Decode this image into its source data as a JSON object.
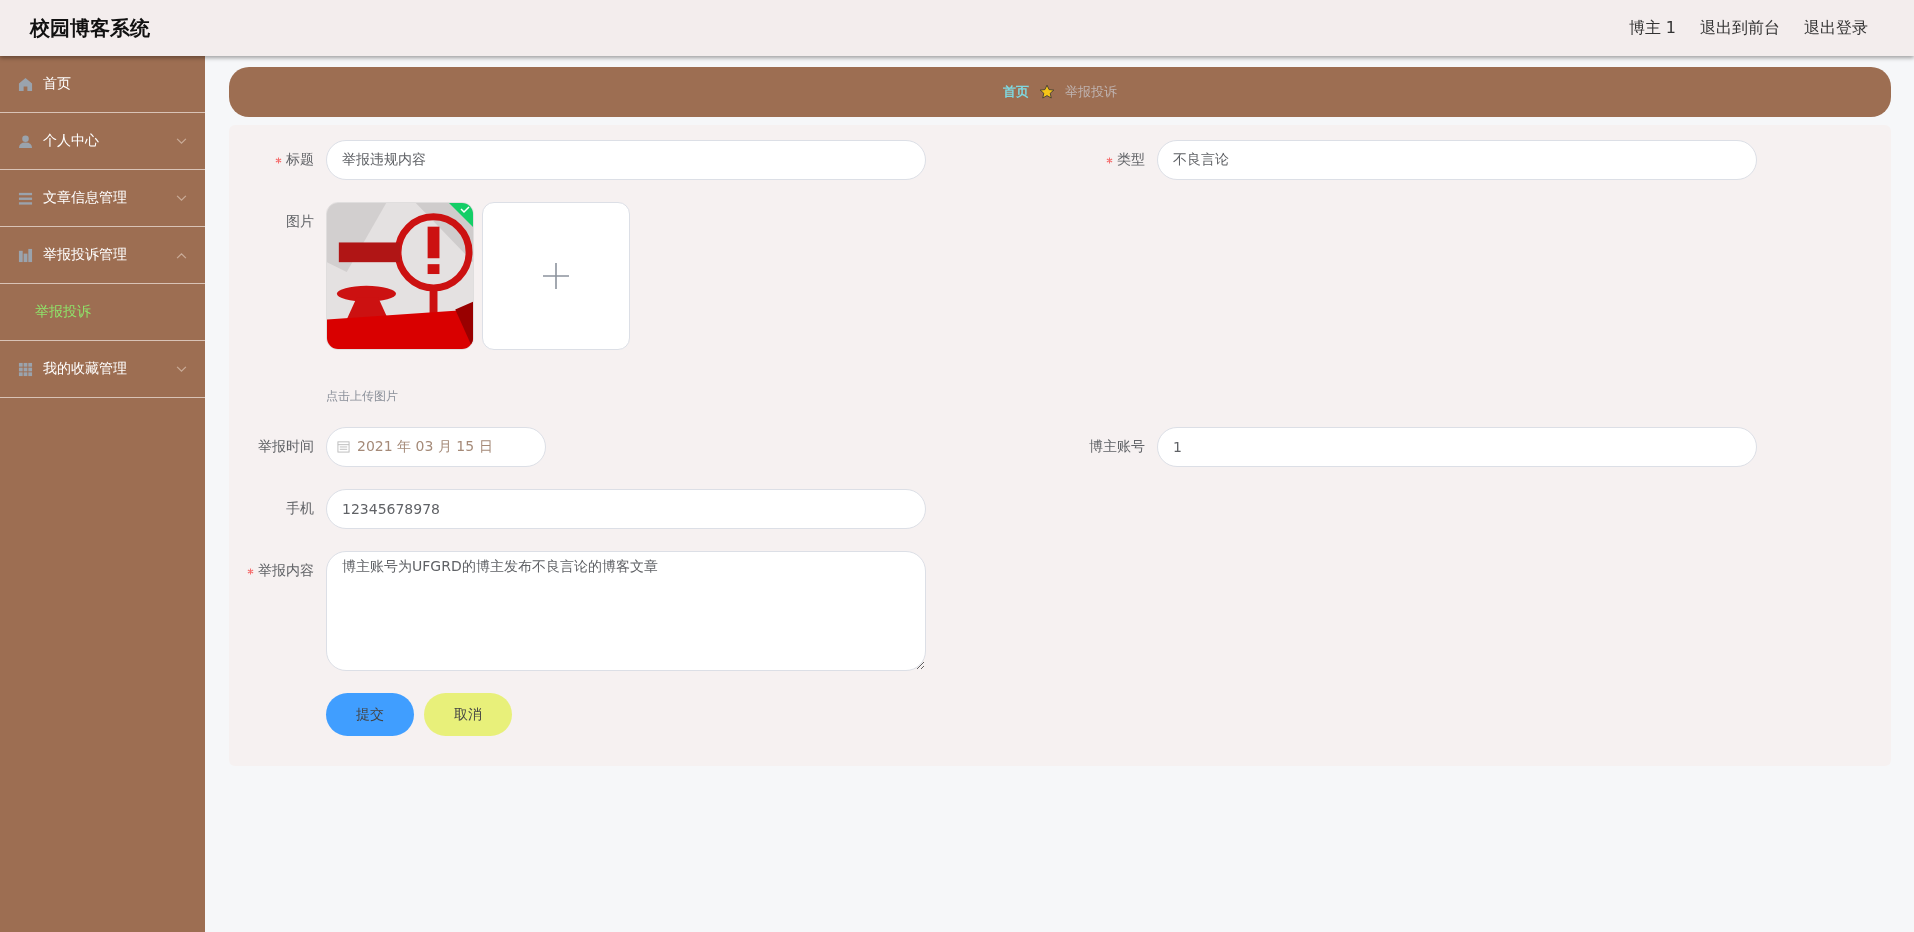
{
  "header": {
    "title": "校园博客系统",
    "links": [
      "博主 1",
      "退出到前台",
      "退出登录"
    ]
  },
  "sidebar": {
    "items": [
      {
        "label": "首页"
      },
      {
        "label": "个人中心",
        "expanded": false
      },
      {
        "label": "文章信息管理",
        "expanded": false
      },
      {
        "label": "举报投诉管理",
        "expanded": true,
        "children": [
          {
            "label": "举报投诉",
            "selected": true
          }
        ]
      },
      {
        "label": "我的收藏管理",
        "expanded": false
      }
    ]
  },
  "breadcrumb": [
    {
      "label": "首页",
      "current": false
    },
    {
      "label": "举报投诉",
      "current": true
    }
  ],
  "form": {
    "rows": [
      [
        {
          "kind": "text",
          "label": "标题",
          "required": true,
          "value": "举报违规内容"
        },
        {
          "kind": "text",
          "label": "类型",
          "required": true,
          "value": "不良言论"
        }
      ],
      [
        {
          "kind": "upload",
          "label": "图片",
          "required": false,
          "images": [
            {
              "kind": "picture",
              "uploaded": true
            }
          ],
          "hint": "点击上传图片"
        }
      ],
      [
        {
          "kind": "date",
          "label": "举报时间",
          "required": false,
          "value": "2021 年 03 月 15 日"
        },
        {
          "kind": "text",
          "label": "博主账号",
          "required": false,
          "value": "1"
        }
      ],
      [
        {
          "kind": "text",
          "label": "手机",
          "required": false,
          "value": "12345678978"
        }
      ],
      [
        {
          "kind": "textarea",
          "label": "举报内容",
          "required": true,
          "value": "博主账号为UFGRD的博主发布不良言论的博客文章"
        }
      ]
    ],
    "buttons": [
      {
        "kind": "submit",
        "label": "提交"
      },
      {
        "kind": "cancel",
        "label": "取消"
      }
    ]
  }
}
